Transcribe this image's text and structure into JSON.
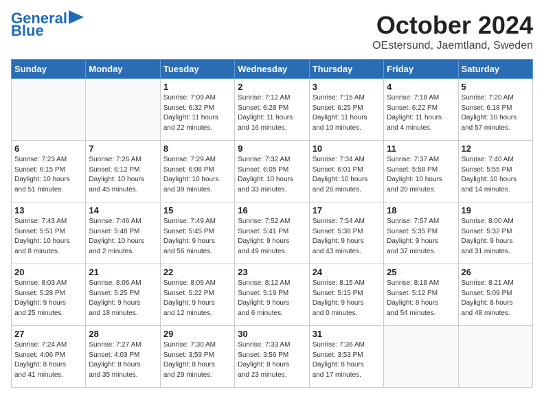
{
  "logo": {
    "line1": "General",
    "line2": "Blue"
  },
  "title": "October 2024",
  "subtitle": "OEstersund, Jaemtland, Sweden",
  "days_of_week": [
    "Sunday",
    "Monday",
    "Tuesday",
    "Wednesday",
    "Thursday",
    "Friday",
    "Saturday"
  ],
  "weeks": [
    [
      {
        "day": "",
        "info": ""
      },
      {
        "day": "",
        "info": ""
      },
      {
        "day": "1",
        "info": "Sunrise: 7:09 AM\nSunset: 6:32 PM\nDaylight: 11 hours\nand 22 minutes."
      },
      {
        "day": "2",
        "info": "Sunrise: 7:12 AM\nSunset: 6:28 PM\nDaylight: 11 hours\nand 16 minutes."
      },
      {
        "day": "3",
        "info": "Sunrise: 7:15 AM\nSunset: 6:25 PM\nDaylight: 11 hours\nand 10 minutes."
      },
      {
        "day": "4",
        "info": "Sunrise: 7:18 AM\nSunset: 6:22 PM\nDaylight: 11 hours\nand 4 minutes."
      },
      {
        "day": "5",
        "info": "Sunrise: 7:20 AM\nSunset: 6:18 PM\nDaylight: 10 hours\nand 57 minutes."
      }
    ],
    [
      {
        "day": "6",
        "info": "Sunrise: 7:23 AM\nSunset: 6:15 PM\nDaylight: 10 hours\nand 51 minutes."
      },
      {
        "day": "7",
        "info": "Sunrise: 7:26 AM\nSunset: 6:12 PM\nDaylight: 10 hours\nand 45 minutes."
      },
      {
        "day": "8",
        "info": "Sunrise: 7:29 AM\nSunset: 6:08 PM\nDaylight: 10 hours\nand 39 minutes."
      },
      {
        "day": "9",
        "info": "Sunrise: 7:32 AM\nSunset: 6:05 PM\nDaylight: 10 hours\nand 33 minutes."
      },
      {
        "day": "10",
        "info": "Sunrise: 7:34 AM\nSunset: 6:01 PM\nDaylight: 10 hours\nand 26 minutes."
      },
      {
        "day": "11",
        "info": "Sunrise: 7:37 AM\nSunset: 5:58 PM\nDaylight: 10 hours\nand 20 minutes."
      },
      {
        "day": "12",
        "info": "Sunrise: 7:40 AM\nSunset: 5:55 PM\nDaylight: 10 hours\nand 14 minutes."
      }
    ],
    [
      {
        "day": "13",
        "info": "Sunrise: 7:43 AM\nSunset: 5:51 PM\nDaylight: 10 hours\nand 8 minutes."
      },
      {
        "day": "14",
        "info": "Sunrise: 7:46 AM\nSunset: 5:48 PM\nDaylight: 10 hours\nand 2 minutes."
      },
      {
        "day": "15",
        "info": "Sunrise: 7:49 AM\nSunset: 5:45 PM\nDaylight: 9 hours\nand 56 minutes."
      },
      {
        "day": "16",
        "info": "Sunrise: 7:52 AM\nSunset: 5:41 PM\nDaylight: 9 hours\nand 49 minutes."
      },
      {
        "day": "17",
        "info": "Sunrise: 7:54 AM\nSunset: 5:38 PM\nDaylight: 9 hours\nand 43 minutes."
      },
      {
        "day": "18",
        "info": "Sunrise: 7:57 AM\nSunset: 5:35 PM\nDaylight: 9 hours\nand 37 minutes."
      },
      {
        "day": "19",
        "info": "Sunrise: 8:00 AM\nSunset: 5:32 PM\nDaylight: 9 hours\nand 31 minutes."
      }
    ],
    [
      {
        "day": "20",
        "info": "Sunrise: 8:03 AM\nSunset: 5:28 PM\nDaylight: 9 hours\nand 25 minutes."
      },
      {
        "day": "21",
        "info": "Sunrise: 8:06 AM\nSunset: 5:25 PM\nDaylight: 9 hours\nand 18 minutes."
      },
      {
        "day": "22",
        "info": "Sunrise: 8:09 AM\nSunset: 5:22 PM\nDaylight: 9 hours\nand 12 minutes."
      },
      {
        "day": "23",
        "info": "Sunrise: 8:12 AM\nSunset: 5:19 PM\nDaylight: 9 hours\nand 6 minutes."
      },
      {
        "day": "24",
        "info": "Sunrise: 8:15 AM\nSunset: 5:15 PM\nDaylight: 9 hours\nand 0 minutes."
      },
      {
        "day": "25",
        "info": "Sunrise: 8:18 AM\nSunset: 5:12 PM\nDaylight: 8 hours\nand 54 minutes."
      },
      {
        "day": "26",
        "info": "Sunrise: 8:21 AM\nSunset: 5:09 PM\nDaylight: 8 hours\nand 48 minutes."
      }
    ],
    [
      {
        "day": "27",
        "info": "Sunrise: 7:24 AM\nSunset: 4:06 PM\nDaylight: 8 hours\nand 41 minutes."
      },
      {
        "day": "28",
        "info": "Sunrise: 7:27 AM\nSunset: 4:03 PM\nDaylight: 8 hours\nand 35 minutes."
      },
      {
        "day": "29",
        "info": "Sunrise: 7:30 AM\nSunset: 3:59 PM\nDaylight: 8 hours\nand 29 minutes."
      },
      {
        "day": "30",
        "info": "Sunrise: 7:33 AM\nSunset: 3:56 PM\nDaylight: 8 hours\nand 23 minutes."
      },
      {
        "day": "31",
        "info": "Sunrise: 7:36 AM\nSunset: 3:53 PM\nDaylight: 8 hours\nand 17 minutes."
      },
      {
        "day": "",
        "info": ""
      },
      {
        "day": "",
        "info": ""
      }
    ]
  ]
}
